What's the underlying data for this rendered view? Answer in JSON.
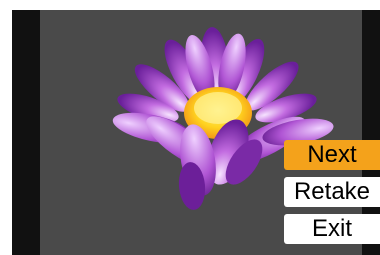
{
  "menu": {
    "items": [
      {
        "label": "Next",
        "selected": true
      },
      {
        "label": "Retake",
        "selected": false
      },
      {
        "label": "Exit",
        "selected": false
      }
    ]
  },
  "preview": {
    "subject": "water-lily-photo"
  },
  "colors": {
    "selected": "#f4a21b",
    "button": "#ffffff",
    "background": "#4a4a4a"
  }
}
